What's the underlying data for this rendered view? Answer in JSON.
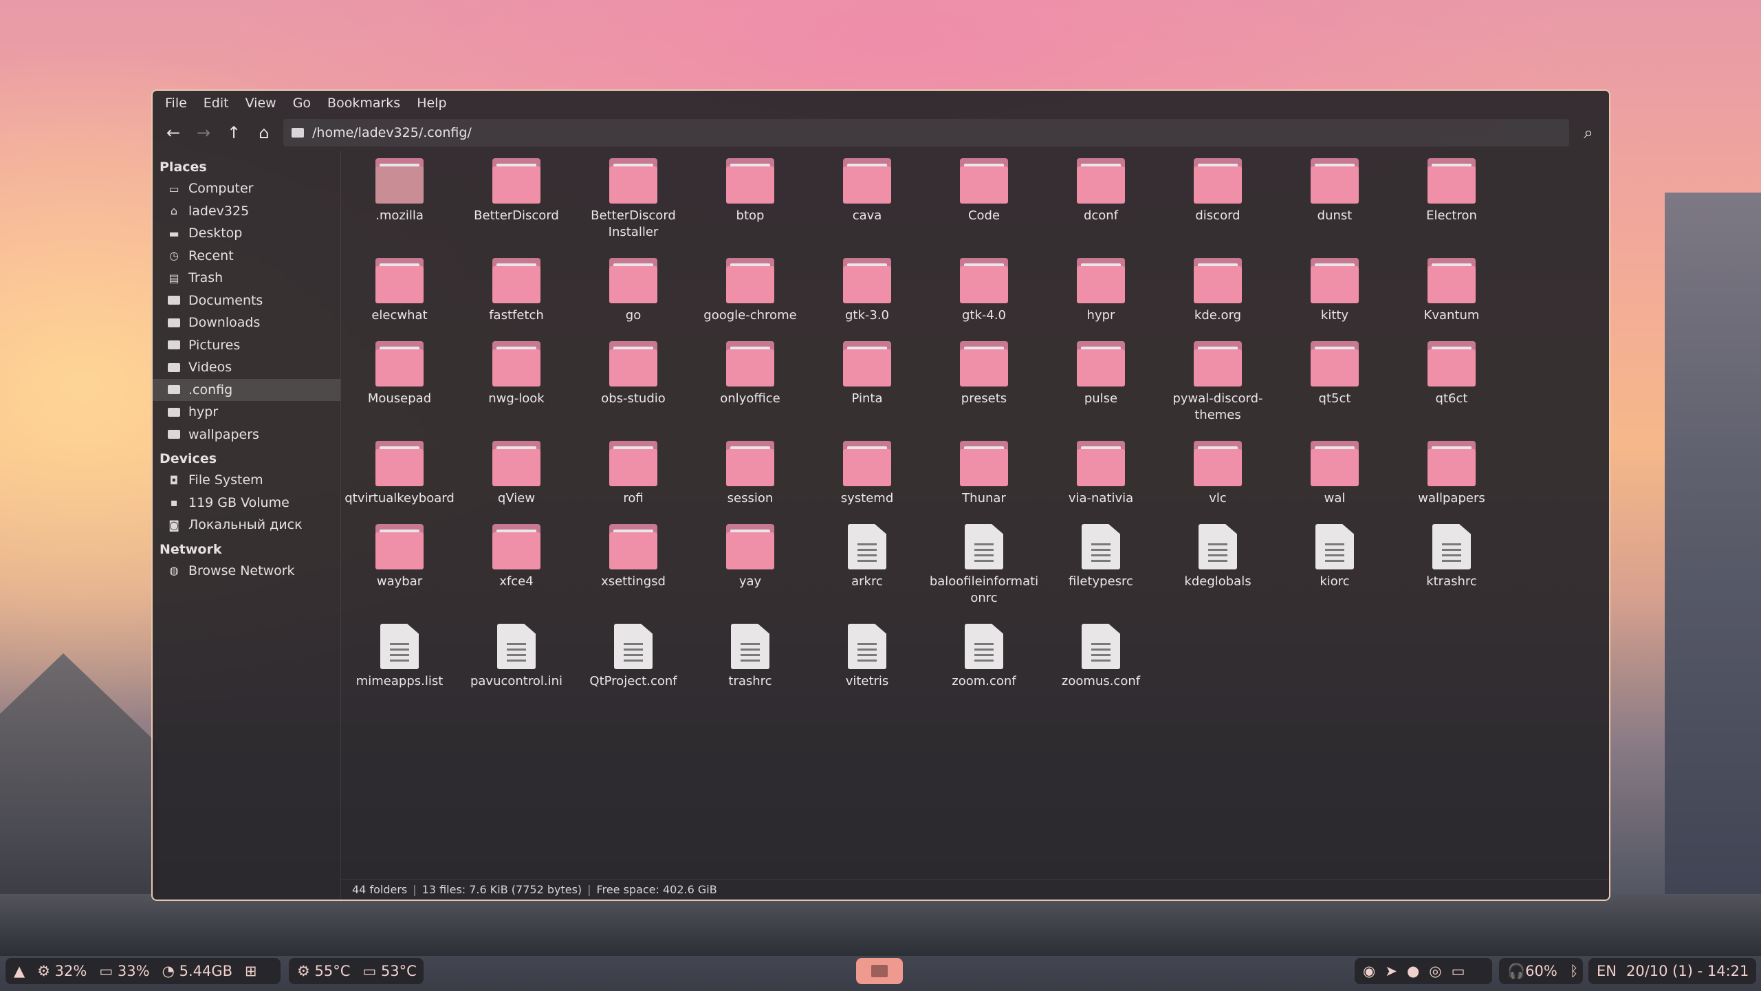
{
  "menu": [
    "File",
    "Edit",
    "View",
    "Go",
    "Bookmarks",
    "Help"
  ],
  "toolbar": {
    "back_icon": "←",
    "forward_icon": "→",
    "up_icon": "↑",
    "home_icon": "⌂",
    "path": "/home/ladev325/.config/",
    "search_icon": "⌕"
  },
  "sidebar": {
    "places_title": "Places",
    "places": [
      {
        "label": "Computer",
        "icon": "▭"
      },
      {
        "label": "ladev325",
        "icon": "⌂"
      },
      {
        "label": "Desktop",
        "icon": "▬"
      },
      {
        "label": "Recent",
        "icon": "◷"
      },
      {
        "label": "Trash",
        "icon": "▤"
      },
      {
        "label": "Documents",
        "icon": "folder"
      },
      {
        "label": "Downloads",
        "icon": "folder"
      },
      {
        "label": "Pictures",
        "icon": "folder"
      },
      {
        "label": "Videos",
        "icon": "folder"
      },
      {
        "label": ".config",
        "icon": "folder"
      },
      {
        "label": "hypr",
        "icon": "folder"
      },
      {
        "label": "wallpapers",
        "icon": "folder"
      }
    ],
    "devices_title": "Devices",
    "devices": [
      {
        "label": "File System",
        "icon": "◘"
      },
      {
        "label": "119 GB Volume",
        "icon": "▪"
      },
      {
        "label": "Локальный диск",
        "icon": "◙"
      }
    ],
    "network_title": "Network",
    "network": [
      {
        "label": "Browse Network",
        "icon": "◍"
      }
    ]
  },
  "items": [
    {
      "name": ".mozilla",
      "type": "folder"
    },
    {
      "name": "BetterDiscord",
      "type": "folder"
    },
    {
      "name": "BetterDiscord Installer",
      "type": "folder"
    },
    {
      "name": "btop",
      "type": "folder"
    },
    {
      "name": "cava",
      "type": "folder"
    },
    {
      "name": "Code",
      "type": "folder"
    },
    {
      "name": "dconf",
      "type": "folder"
    },
    {
      "name": "discord",
      "type": "folder"
    },
    {
      "name": "dunst",
      "type": "folder"
    },
    {
      "name": "Electron",
      "type": "folder"
    },
    {
      "name": "elecwhat",
      "type": "folder"
    },
    {
      "name": "fastfetch",
      "type": "folder"
    },
    {
      "name": "go",
      "type": "folder"
    },
    {
      "name": "google-chrome",
      "type": "folder"
    },
    {
      "name": "gtk-3.0",
      "type": "folder"
    },
    {
      "name": "gtk-4.0",
      "type": "folder"
    },
    {
      "name": "hypr",
      "type": "folder"
    },
    {
      "name": "kde.org",
      "type": "folder"
    },
    {
      "name": "kitty",
      "type": "folder"
    },
    {
      "name": "Kvantum",
      "type": "folder"
    },
    {
      "name": "Mousepad",
      "type": "folder"
    },
    {
      "name": "nwg-look",
      "type": "folder"
    },
    {
      "name": "obs-studio",
      "type": "folder"
    },
    {
      "name": "onlyoffice",
      "type": "folder"
    },
    {
      "name": "Pinta",
      "type": "folder"
    },
    {
      "name": "presets",
      "type": "folder"
    },
    {
      "name": "pulse",
      "type": "folder"
    },
    {
      "name": "pywal-discord-themes",
      "type": "folder"
    },
    {
      "name": "qt5ct",
      "type": "folder"
    },
    {
      "name": "qt6ct",
      "type": "folder"
    },
    {
      "name": "qtvirtualkeyboard",
      "type": "folder"
    },
    {
      "name": "qView",
      "type": "folder"
    },
    {
      "name": "rofi",
      "type": "folder"
    },
    {
      "name": "session",
      "type": "folder"
    },
    {
      "name": "systemd",
      "type": "folder"
    },
    {
      "name": "Thunar",
      "type": "folder"
    },
    {
      "name": "via-nativia",
      "type": "folder"
    },
    {
      "name": "vlc",
      "type": "folder"
    },
    {
      "name": "wal",
      "type": "folder"
    },
    {
      "name": "wallpapers",
      "type": "folder"
    },
    {
      "name": "waybar",
      "type": "folder"
    },
    {
      "name": "xfce4",
      "type": "folder"
    },
    {
      "name": "xsettingsd",
      "type": "folder"
    },
    {
      "name": "yay",
      "type": "folder"
    },
    {
      "name": "arkrc",
      "type": "file"
    },
    {
      "name": "baloofileinformationrc",
      "type": "file"
    },
    {
      "name": "filetypesrc",
      "type": "file"
    },
    {
      "name": "kdeglobals",
      "type": "file"
    },
    {
      "name": "kiorc",
      "type": "file"
    },
    {
      "name": "ktrashrc",
      "type": "file"
    },
    {
      "name": "mimeapps.list",
      "type": "file"
    },
    {
      "name": "pavucontrol.ini",
      "type": "file"
    },
    {
      "name": "QtProject.conf",
      "type": "file"
    },
    {
      "name": "trashrc",
      "type": "file"
    },
    {
      "name": "vitetris",
      "type": "file"
    },
    {
      "name": "zoom.conf",
      "type": "file"
    },
    {
      "name": "zoomus.conf",
      "type": "file"
    }
  ],
  "status": {
    "folders": "44 folders",
    "files": "13 files: 7.6 KiB (7752 bytes)",
    "free": "Free space: 402.6 GiB"
  },
  "taskbar": {
    "cpu": "32%",
    "mem": "33%",
    "disk": "5.44GB",
    "temp1": "55°C",
    "temp2": "53°C",
    "volume": "60%",
    "lang": "EN",
    "datetime": "20/10 (1) - 14:21"
  },
  "colors": {
    "folder": "#ef8fa8",
    "accent": "#e8c9b0"
  }
}
